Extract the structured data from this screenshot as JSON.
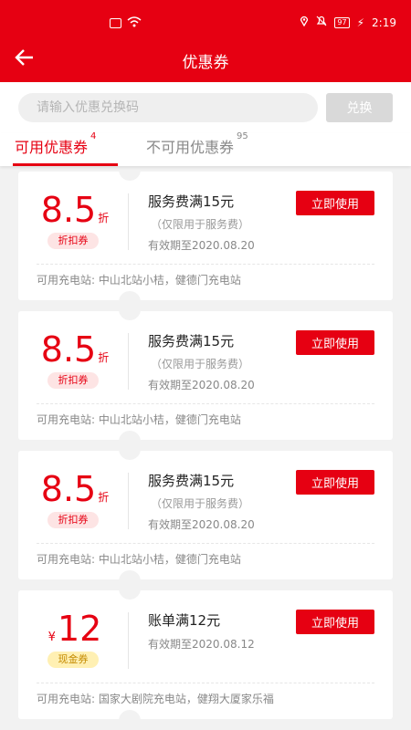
{
  "status_bar": {
    "battery": "97",
    "time": "2:19"
  },
  "header": {
    "title": "优惠券"
  },
  "redeem": {
    "placeholder": "请输入优惠兑换码",
    "button_label": "兑换"
  },
  "tabs": [
    {
      "label": "可用优惠券",
      "count": "4"
    },
    {
      "label": "不可用优惠券",
      "count": "95"
    }
  ],
  "coupons": [
    {
      "value": "8.5",
      "unit": "折",
      "type_label": "折扣券",
      "title": "服务费满15元",
      "limit": "（仅限用于服务费）",
      "expiry": "有效期至2020.08.20",
      "stations": "可用充电站: 中山北站小桔，健德门充电站",
      "button_label": "立即使用"
    },
    {
      "value": "8.5",
      "unit": "折",
      "type_label": "折扣券",
      "title": "服务费满15元",
      "limit": "（仅限用于服务费）",
      "expiry": "有效期至2020.08.20",
      "stations": "可用充电站: 中山北站小桔，健德门充电站",
      "button_label": "立即使用"
    },
    {
      "value": "8.5",
      "unit": "折",
      "type_label": "折扣券",
      "title": "服务费满15元",
      "limit": "（仅限用于服务费）",
      "expiry": "有效期至2020.08.20",
      "stations": "可用充电站: 中山北站小桔，健德门充电站",
      "button_label": "立即使用"
    },
    {
      "currency": "¥",
      "value": "12",
      "type_label": "现金券",
      "title": "账单满12元",
      "expiry": "有效期至2020.08.12",
      "stations": "可用充电站: 国家大剧院充电站，健翔大厦家乐福",
      "button_label": "立即使用"
    }
  ],
  "colors": {
    "brand": "#e60012",
    "background": "#f2f2f2",
    "cash_tag": "#fff0b3"
  }
}
